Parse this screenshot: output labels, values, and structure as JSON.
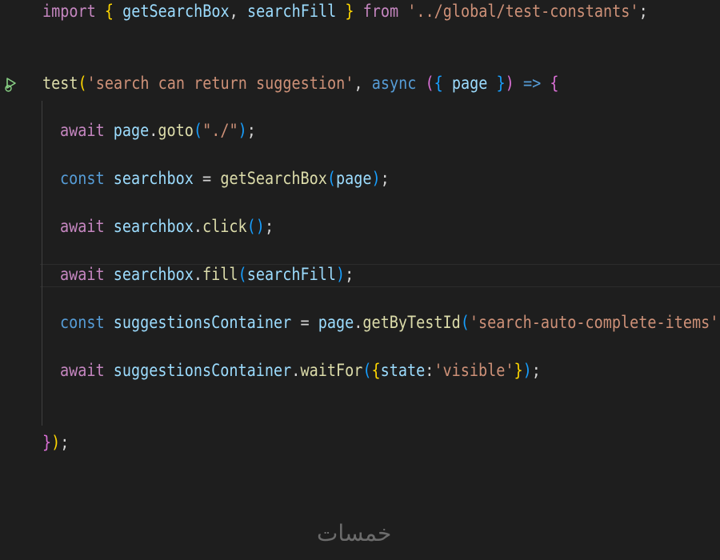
{
  "code": {
    "line1": {
      "t1": "import",
      "t2": "{",
      "t3": "getSearchBox",
      "t4": ",",
      "t5": "searchFill",
      "t6": "}",
      "t7": "from",
      "t8": "'../global/test-constants'",
      "t9": ";"
    },
    "line2": {
      "t1": "test",
      "t2": "(",
      "t3": "'search can return suggestion'",
      "t4": ",",
      "t5": "async",
      "t6": "(",
      "t7": "{",
      "t8": "page",
      "t9": "}",
      "t10": ")",
      "t11": "=>",
      "t12": "{"
    },
    "line3": {
      "t1": "await",
      "t2": "page",
      "t3": ".",
      "t4": "goto",
      "t5": "(",
      "t6": "\"./\"",
      "t7": ")",
      "t8": ";"
    },
    "line4": {
      "t1": "const",
      "t2": "searchbox",
      "t3": "=",
      "t4": "getSearchBox",
      "t5": "(",
      "t6": "page",
      "t7": ")",
      "t8": ";"
    },
    "line5": {
      "t1": "await",
      "t2": "searchbox",
      "t3": ".",
      "t4": "click",
      "t5": "()",
      "t6": ";"
    },
    "line6": {
      "t1": "await",
      "t2": "searchbox",
      "t3": ".",
      "t4": "fill",
      "t5": "(",
      "t6": "searchFill",
      "t7": ")",
      "t8": ";"
    },
    "line7": {
      "t1": "const",
      "t2": "suggestionsContainer",
      "t3": "=",
      "t4": "page",
      "t5": ".",
      "t6": "getByTestId",
      "t7": "(",
      "t8": "'search-auto-complete-items'",
      "t9": ")"
    },
    "line8": {
      "t1": "await",
      "t2": "suggestionsContainer",
      "t3": ".",
      "t4": "waitFor",
      "t5": "(",
      "t6": "{",
      "t7": "state",
      "t8": ":",
      "t9": "'visible'",
      "t10": "}",
      "t11": ")",
      "t12": ";"
    },
    "line9": {
      "t1": "}",
      "t2": ")",
      "t3": ";"
    }
  },
  "watermark": "خمسات",
  "colors": {
    "background": "#1e1e1e",
    "keyword_control": "#c586c0",
    "keyword": "#569cd6",
    "variable": "#9cdcfe",
    "function": "#dcdcaa",
    "string": "#ce9178",
    "bracket_level1": "#ffd700",
    "bracket_level2": "#da70d6",
    "bracket_level3": "#179fff",
    "run_icon": "#89d185"
  },
  "icons": {
    "gutter": "run-test-icon"
  }
}
